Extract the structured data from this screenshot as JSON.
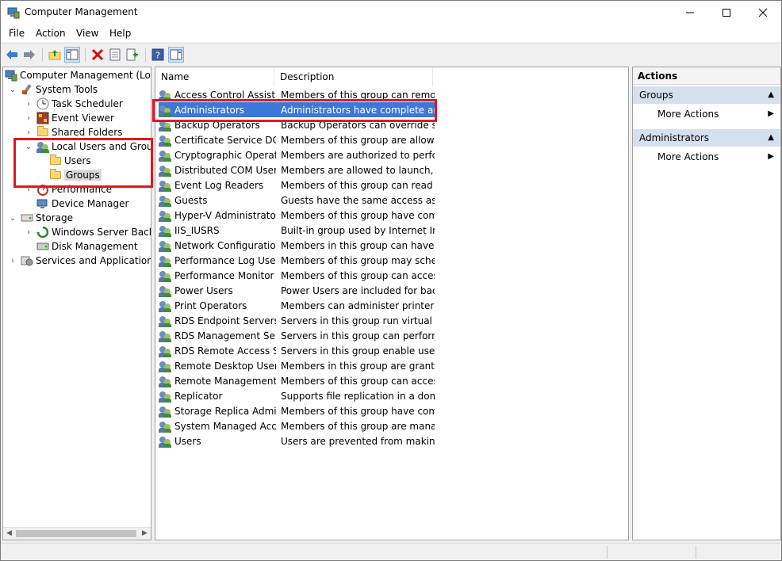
{
  "window": {
    "title": "Computer Management"
  },
  "menu": {
    "file": "File",
    "action": "Action",
    "view": "View",
    "help": "Help"
  },
  "toolbar": {
    "buttons": [
      "back-icon",
      "forward-icon",
      "up-folder-icon",
      "show-hide-tree-icon",
      "delete-icon",
      "properties-icon",
      "export-list-icon",
      "help-icon",
      "show-hide-action-pane-icon"
    ]
  },
  "tree": {
    "items": [
      {
        "label": "Computer Management (Local",
        "icon": "computer-management-icon"
      },
      {
        "label": "System Tools",
        "icon": "tools-icon"
      },
      {
        "label": "Task Scheduler",
        "icon": "clock-icon"
      },
      {
        "label": "Event Viewer",
        "icon": "event-viewer-icon"
      },
      {
        "label": "Shared Folders",
        "icon": "shared-folder-icon"
      },
      {
        "label": "Local Users and Groups",
        "icon": "users-groups-icon"
      },
      {
        "label": "Users",
        "icon": "folder-icon"
      },
      {
        "label": "Groups",
        "icon": "folder-icon"
      },
      {
        "label": "Performance",
        "icon": "performance-icon"
      },
      {
        "label": "Device Manager",
        "icon": "device-manager-icon"
      },
      {
        "label": "Storage",
        "icon": "storage-icon"
      },
      {
        "label": "Windows Server Backup",
        "icon": "backup-icon"
      },
      {
        "label": "Disk Management",
        "icon": "disk-icon"
      },
      {
        "label": "Services and Applications",
        "icon": "services-icon"
      }
    ]
  },
  "list": {
    "columns": [
      "Name",
      "Description"
    ],
    "rows": [
      {
        "name": "Access Control Assist...",
        "desc": "Members of this group can remot..."
      },
      {
        "name": "Administrators",
        "desc": "Administrators have complete an..."
      },
      {
        "name": "Backup Operators",
        "desc": "Backup Operators can override se..."
      },
      {
        "name": "Certificate Service DC...",
        "desc": "Members of this group are allowe..."
      },
      {
        "name": "Cryptographic Operat...",
        "desc": "Members are authorized to perfor..."
      },
      {
        "name": "Distributed COM Users",
        "desc": "Members are allowed to launch, a..."
      },
      {
        "name": "Event Log Readers",
        "desc": "Members of this group can read e..."
      },
      {
        "name": "Guests",
        "desc": "Guests have the same access as m..."
      },
      {
        "name": "Hyper-V Administrators",
        "desc": "Members of this group have com..."
      },
      {
        "name": "IIS_IUSRS",
        "desc": "Built-in group used by Internet Inf..."
      },
      {
        "name": "Network Configuratio...",
        "desc": "Members in this group can have s..."
      },
      {
        "name": "Performance Log Users",
        "desc": "Members of this group may sche..."
      },
      {
        "name": "Performance Monitor ...",
        "desc": "Members of this group can acces..."
      },
      {
        "name": "Power Users",
        "desc": "Power Users are included for back..."
      },
      {
        "name": "Print Operators",
        "desc": "Members can administer printers ..."
      },
      {
        "name": "RDS Endpoint Servers",
        "desc": "Servers in this group run virtual m..."
      },
      {
        "name": "RDS Management Ser...",
        "desc": "Servers in this group can perform ..."
      },
      {
        "name": "RDS Remote Access S...",
        "desc": "Servers in this group enable users ..."
      },
      {
        "name": "Remote Desktop Users",
        "desc": "Members in this group are grante..."
      },
      {
        "name": "Remote Management...",
        "desc": "Members of this group can acces..."
      },
      {
        "name": "Replicator",
        "desc": "Supports file replication in a dom..."
      },
      {
        "name": "Storage Replica Admi...",
        "desc": "Members of this group have com..."
      },
      {
        "name": "System Managed Acc...",
        "desc": "Members of this group are mana..."
      },
      {
        "name": "Users",
        "desc": "Users are prevented from making ..."
      }
    ]
  },
  "actions": {
    "title": "Actions",
    "sections": [
      {
        "label": "Groups",
        "item": "More Actions"
      },
      {
        "label": "Administrators",
        "item": "More Actions"
      }
    ]
  },
  "colors": {
    "selection": "#3b78d8",
    "highlight_box": "#e3161f",
    "section_bg": "#d5e0ee"
  }
}
